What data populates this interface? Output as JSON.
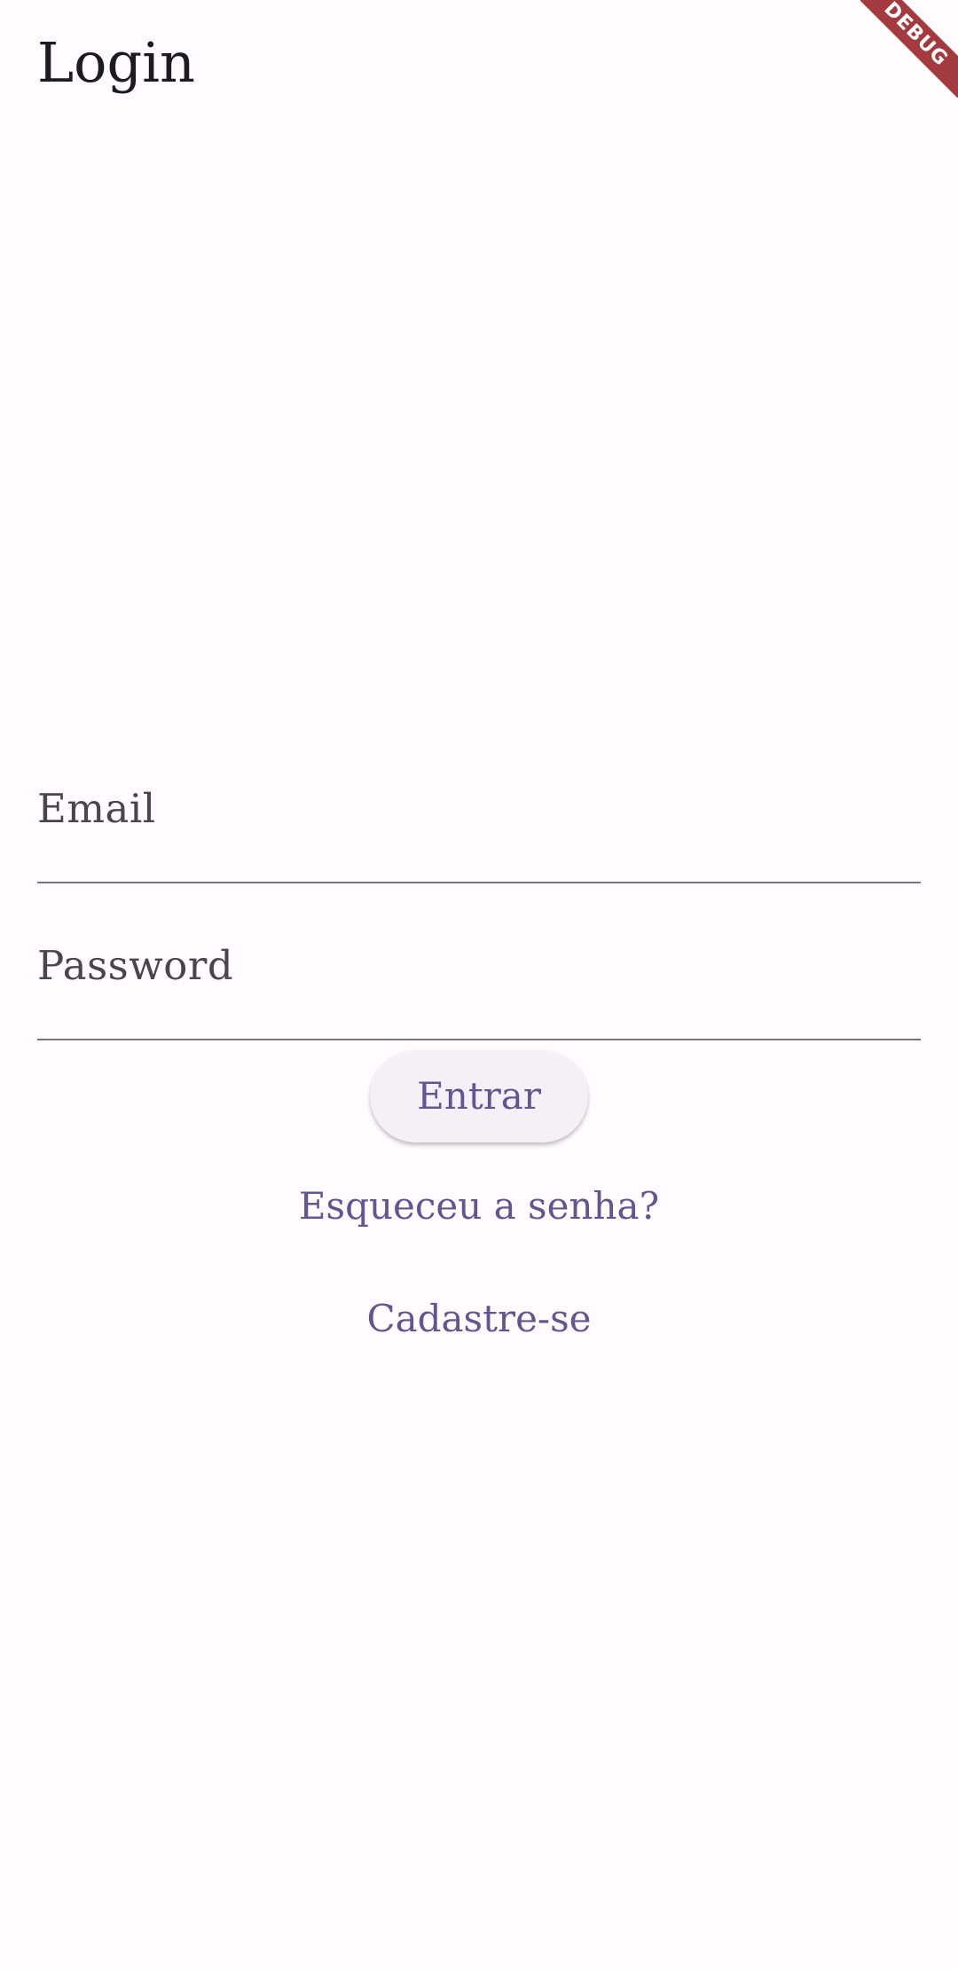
{
  "app_bar": {
    "title": "Login"
  },
  "debug_banner": {
    "label": "DEBUG",
    "color": "#a33a3f"
  },
  "form": {
    "email": {
      "label": "Email",
      "value": ""
    },
    "password": {
      "label": "Password",
      "value": ""
    }
  },
  "actions": {
    "submit_label": "Entrar",
    "forgot_password_label": "Esqueceu a senha?",
    "signup_label": "Cadastre-se"
  },
  "colors": {
    "background": "#fffbfe",
    "accent": "#65558f",
    "field_underline": "#79747e",
    "button_background": "#f5f0f8"
  }
}
